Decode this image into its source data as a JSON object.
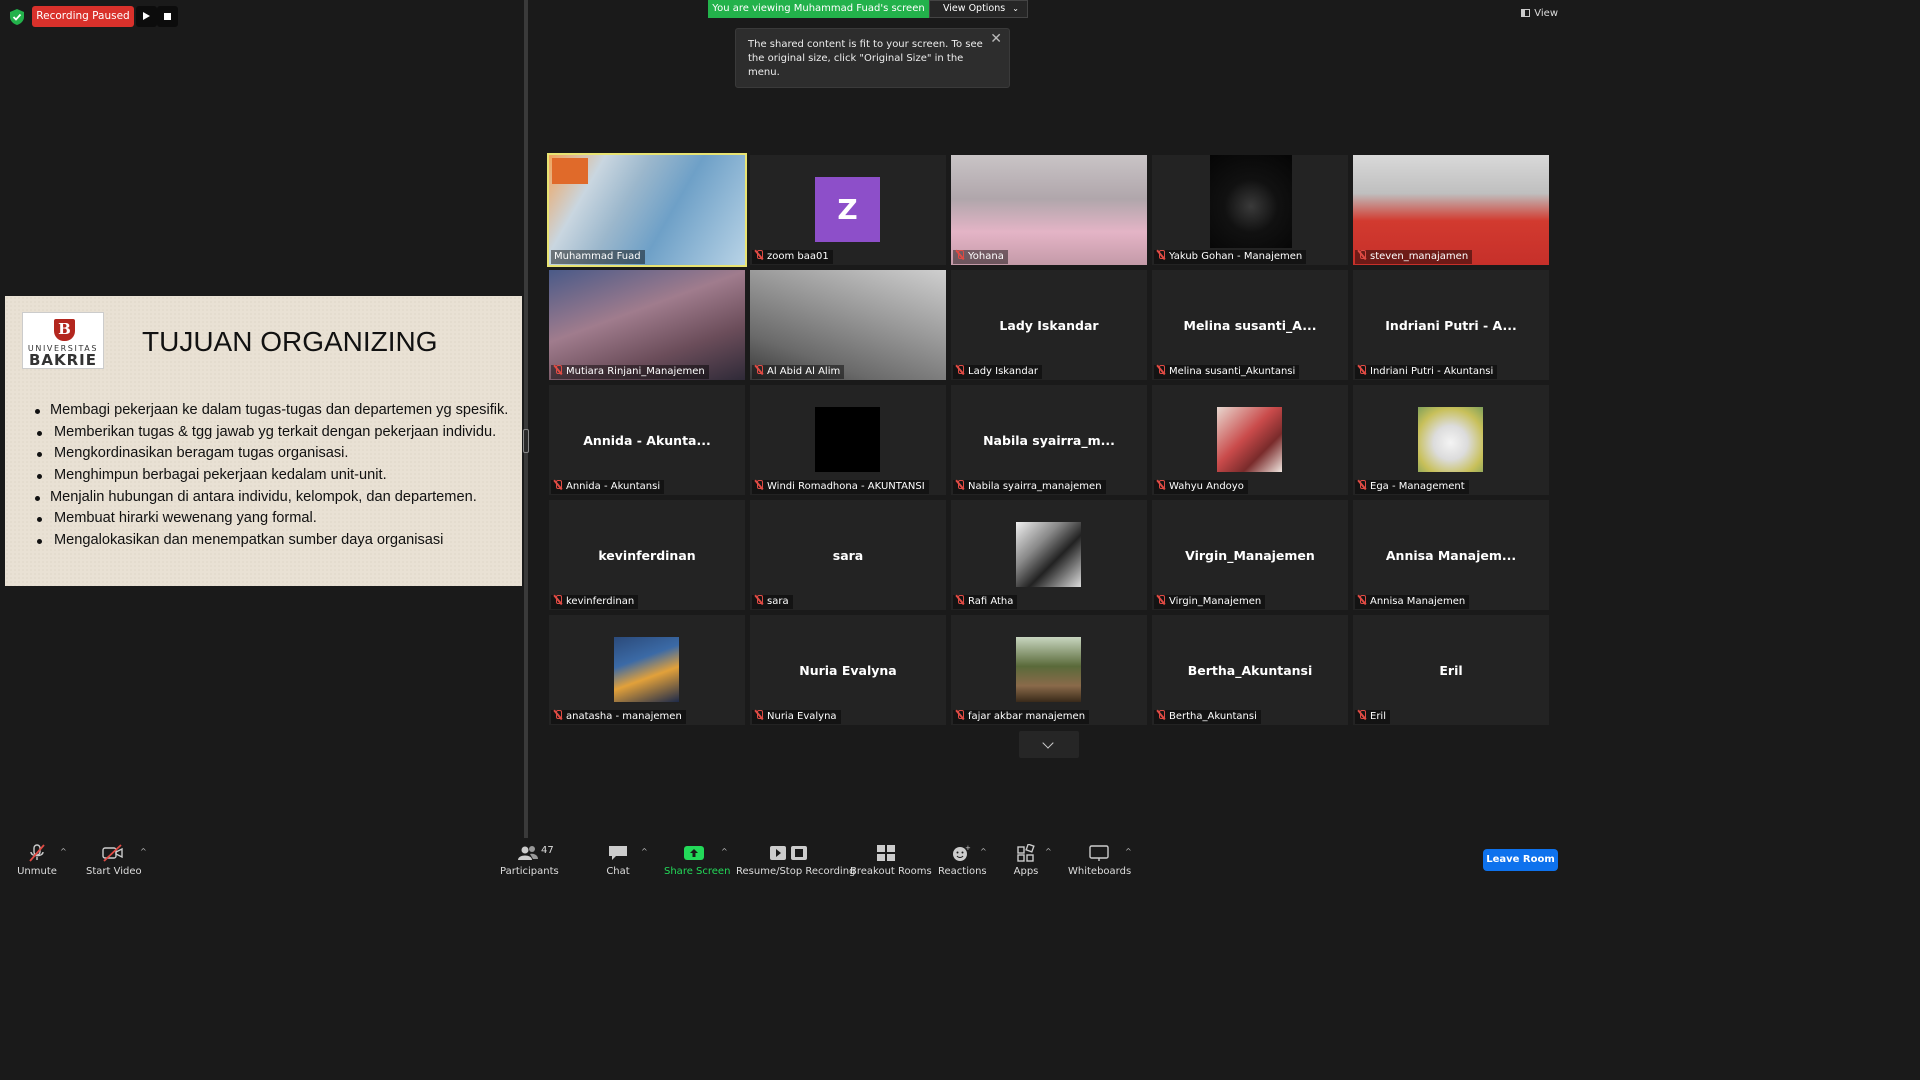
{
  "recording": {
    "status_label": "Recording Paused",
    "shield_icon": "security-shield-icon",
    "resume_icon": "play-icon",
    "stop_icon": "stop-icon"
  },
  "banner": {
    "viewing_text": "You are viewing Muhammad Fuad's screen",
    "view_options_label": "View Options",
    "view_options_caret": "⌄",
    "view_label": "View"
  },
  "tooltip": {
    "text": "The shared content is fit to your screen. To see the original size, click \"Original Size\" in the menu.",
    "close_glyph": "✕"
  },
  "slide": {
    "logo_univ": "UNIVERSITAS",
    "logo_name": "BAKRIE",
    "logo_mark": "B",
    "title": "TUJUAN ORGANIZING",
    "bullets": [
      "Membagi pekerjaan ke dalam tugas-tugas dan departemen yg spesifik.",
      "Memberikan tugas & tgg jawab yg terkait dengan pekerjaan individu.",
      "Mengkordinasikan beragam tugas organisasi.",
      "Menghimpun berbagai pekerjaan kedalam unit-unit.",
      "Menjalin hubungan di antara individu, kelompok, dan departemen.",
      "Membuat hirarki wewenang yang formal.",
      "Mengalokasikan dan menempatkan sumber daya organisasi"
    ]
  },
  "gallery": {
    "tiles": [
      {
        "label": "Muhammad Fuad",
        "center": "",
        "muted": false,
        "kind": "video",
        "active": true
      },
      {
        "label": "zoom baa01",
        "center": "",
        "muted": true,
        "kind": "letter",
        "letter": "Z"
      },
      {
        "label": "Yohana",
        "center": "",
        "muted": true,
        "kind": "video"
      },
      {
        "label": "Yakub Gohan - Manajemen",
        "center": "",
        "muted": true,
        "kind": "dark-video"
      },
      {
        "label": "steven_manajamen",
        "center": "",
        "muted": true,
        "kind": "video"
      },
      {
        "label": "Mutiara Rinjani_Manajemen",
        "center": "",
        "muted": true,
        "kind": "video"
      },
      {
        "label": "Al Abid Al Alim",
        "center": "",
        "muted": true,
        "kind": "video"
      },
      {
        "label": "Lady Iskandar",
        "center": "Lady Iskandar",
        "muted": true,
        "kind": "name"
      },
      {
        "label": "Melina susanti_Akuntansi",
        "center": "Melina  susanti_A...",
        "muted": true,
        "kind": "name"
      },
      {
        "label": "Indriani Putri - Akuntansi",
        "center": "Indriani Putri - A...",
        "muted": true,
        "kind": "name"
      },
      {
        "label": "Annida - Akuntansi",
        "center": "Annida  -  Akunta...",
        "muted": true,
        "kind": "name"
      },
      {
        "label": "Windi Romadhona - AKUNTANSI",
        "center": "",
        "muted": true,
        "kind": "black-avatar"
      },
      {
        "label": "Nabila syairra_manajemen",
        "center": "Nabila  syairra_m...",
        "muted": true,
        "kind": "name"
      },
      {
        "label": "Wahyu Andoyo",
        "center": "",
        "muted": true,
        "kind": "photo"
      },
      {
        "label": "Ega - Management",
        "center": "",
        "muted": true,
        "kind": "photo"
      },
      {
        "label": "kevinferdinan",
        "center": "kevinferdinan",
        "muted": true,
        "kind": "name"
      },
      {
        "label": "sara",
        "center": "sara",
        "muted": true,
        "kind": "name"
      },
      {
        "label": "Rafi Atha",
        "center": "",
        "muted": true,
        "kind": "photo"
      },
      {
        "label": "Virgin_Manajemen",
        "center": "Virgin_Manajemen",
        "muted": true,
        "kind": "name"
      },
      {
        "label": "Annisa Manajemen",
        "center": "Annisa  Manajem...",
        "muted": true,
        "kind": "name"
      },
      {
        "label": "anatasha - manajemen",
        "center": "",
        "muted": true,
        "kind": "photo"
      },
      {
        "label": "Nuria Evalyna",
        "center": "Nuria Evalyna",
        "muted": true,
        "kind": "name"
      },
      {
        "label": "fajar akbar manajemen",
        "center": "",
        "muted": true,
        "kind": "photo"
      },
      {
        "label": "Bertha_Akuntansi",
        "center": "Bertha_Akuntansi",
        "muted": true,
        "kind": "name"
      },
      {
        "label": "Eril",
        "center": "Eril",
        "muted": true,
        "kind": "name"
      }
    ]
  },
  "toolbar": {
    "unmute": "Unmute",
    "start_video": "Start Video",
    "participants": "Participants",
    "participants_count": "47",
    "chat": "Chat",
    "share_screen": "Share Screen",
    "recording": "Resume/Stop Recording",
    "breakout": "Breakout Rooms",
    "reactions": "Reactions",
    "apps": "Apps",
    "whiteboards": "Whiteboards",
    "leave": "Leave Room",
    "caret": "^"
  },
  "colors": {
    "recording_red": "#d9312b",
    "banner_green": "#23b24b",
    "active_speaker": "#e8e372",
    "leave_blue": "#0e72ed",
    "share_green": "#23d959"
  }
}
